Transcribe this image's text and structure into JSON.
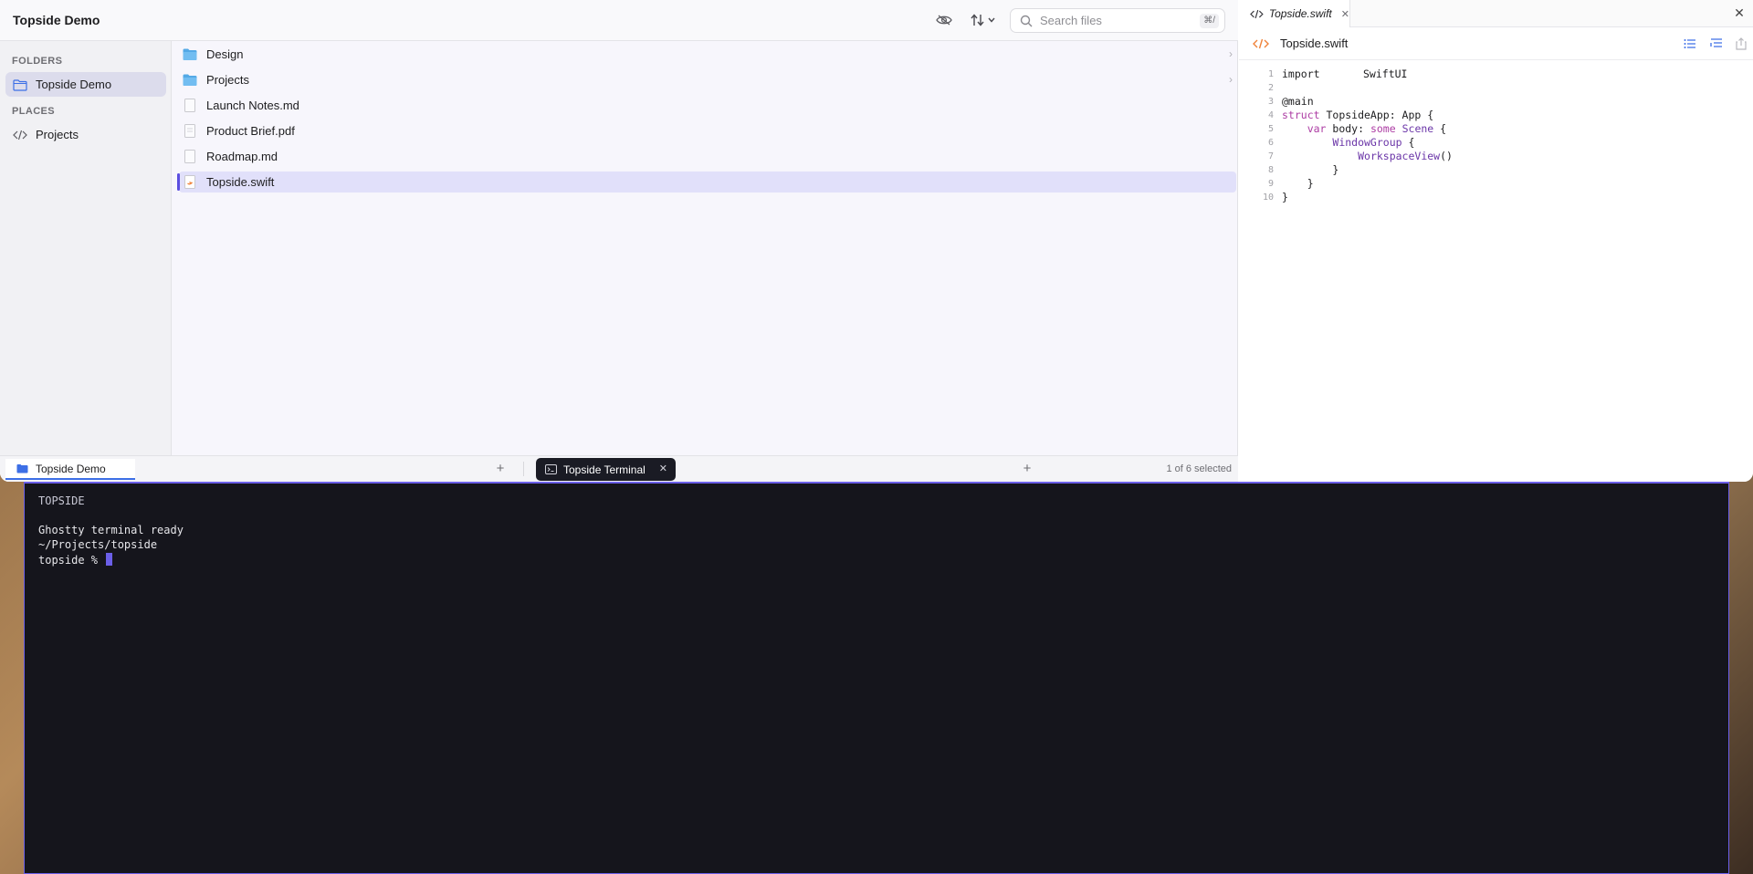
{
  "finder": {
    "title": "Topside Demo",
    "search": {
      "placeholder": "Search files",
      "shortcut": "⌘/"
    },
    "sidebar": {
      "folders_label": "FOLDERS",
      "folders": [
        {
          "label": "Topside Demo",
          "active": true
        }
      ],
      "places_label": "PLACES",
      "places": [
        {
          "label": "Projects"
        }
      ]
    },
    "files": [
      {
        "name": "Design",
        "kind": "folder"
      },
      {
        "name": "Projects",
        "kind": "folder"
      },
      {
        "name": "Launch Notes.md",
        "kind": "file"
      },
      {
        "name": "Product Brief.pdf",
        "kind": "file"
      },
      {
        "name": "Roadmap.md",
        "kind": "file"
      },
      {
        "name": "Topside.swift",
        "kind": "swift",
        "selected": true
      }
    ],
    "footer": {
      "tab_label": "Topside Demo",
      "terminal_tab_label": "Topside Terminal",
      "status": "1 of 6 selected"
    }
  },
  "editor": {
    "tab_label": "Topside.swift",
    "file_label": "Topside.swift",
    "lines": [
      {
        "n": "1",
        "code": "import SwiftUI"
      },
      {
        "n": "2",
        "code": ""
      },
      {
        "n": "3",
        "code": "@main"
      },
      {
        "n": "4",
        "code": "struct TopsideApp: App {"
      },
      {
        "n": "5",
        "code": "    var body: some Scene {"
      },
      {
        "n": "6",
        "code": "        WindowGroup {"
      },
      {
        "n": "7",
        "code": "            WorkspaceView()"
      },
      {
        "n": "8",
        "code": "        }"
      },
      {
        "n": "9",
        "code": "    }"
      },
      {
        "n": "10",
        "code": "}"
      }
    ]
  },
  "terminal": {
    "heading": "TOPSIDE",
    "lines": [
      "Ghostty terminal ready",
      "~/Projects/topside"
    ],
    "prompt": "topside %"
  },
  "colors": {
    "accent": "#5b4ee0",
    "terminal_bg": "#15151c",
    "keyword": "#ad3da4",
    "type": "#6b36a8"
  }
}
